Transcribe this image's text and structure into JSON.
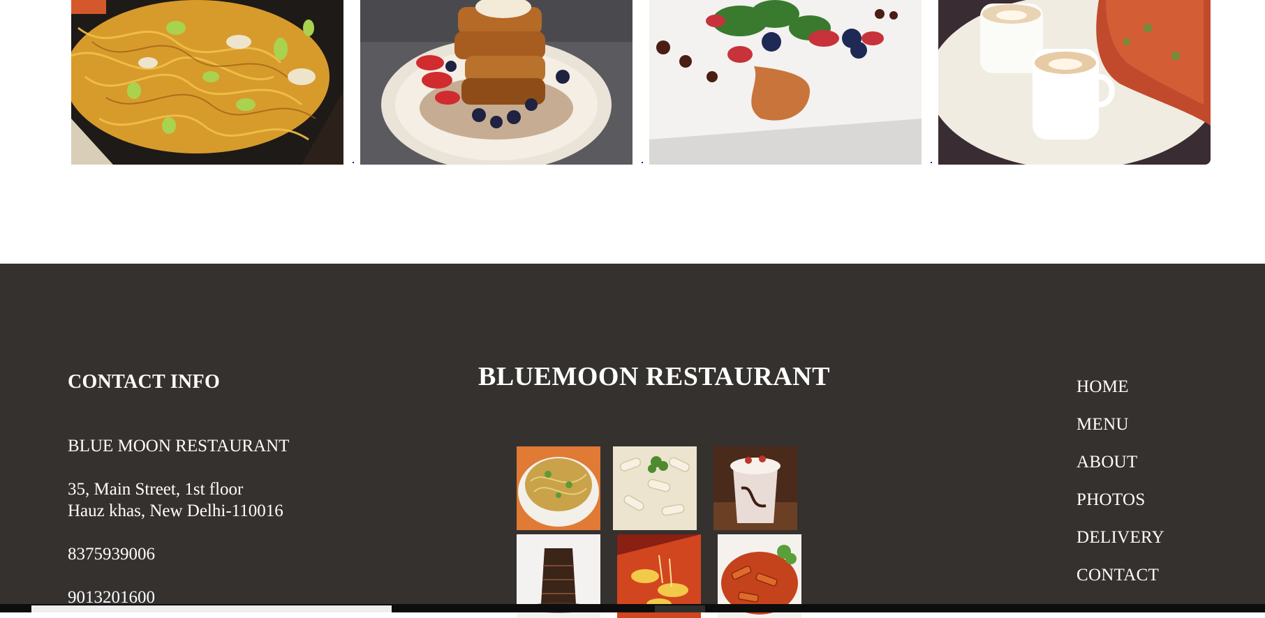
{
  "gallery": {
    "photos": [
      {
        "alt": "noodles-photo"
      },
      {
        "alt": "french-toast-photo"
      },
      {
        "alt": "plated-salad-photo"
      },
      {
        "alt": "coffee-pizza-photo"
      }
    ]
  },
  "footer": {
    "contact": {
      "heading": "CONTACT INFO",
      "name": "BLUE MOON RESTAURANT",
      "address_line1": "35, Main Street, 1st floor",
      "address_line2": "Hauz khas, New Delhi-110016",
      "phone1": "8375939006",
      "phone2": "9013201600"
    },
    "brand": "BLUEMOON RESTAURANT",
    "nav": [
      {
        "label": "HOME"
      },
      {
        "label": "MENU"
      },
      {
        "label": "ABOUT"
      },
      {
        "label": "PHOTOS"
      },
      {
        "label": "DELIVERY"
      },
      {
        "label": "CONTACT"
      }
    ]
  },
  "colors": {
    "footer_bg": "#35312e",
    "footer_text": "#ffffff",
    "page_bg": "#ffffff"
  }
}
